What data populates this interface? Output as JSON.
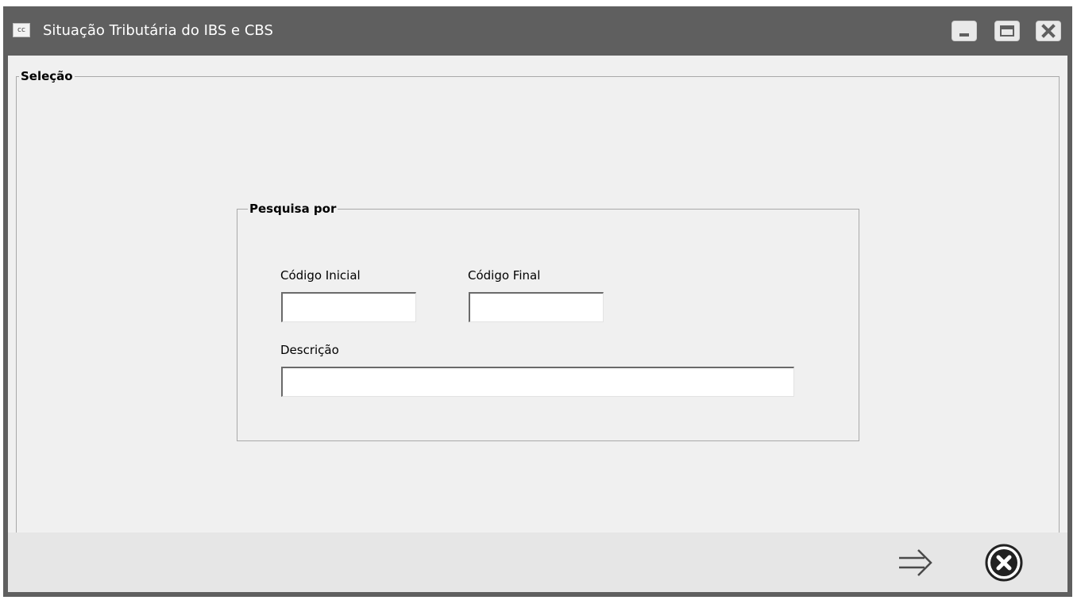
{
  "window": {
    "app_icon_label": "cc",
    "title": "Situação Tributária do IBS e CBS",
    "controls": [
      "minimize-icon",
      "maximize-icon",
      "close-icon"
    ]
  },
  "selecao": {
    "legend": "Seleção",
    "pesquisa": {
      "legend": "Pesquisa por",
      "codigo_inicial": {
        "label": "Código Inicial",
        "value": ""
      },
      "codigo_final": {
        "label": "Código Final",
        "value": ""
      },
      "descricao": {
        "label": "Descrição",
        "value": ""
      }
    }
  },
  "footer": {
    "actions": [
      "arrow-right-icon",
      "cancel-x-circle-icon"
    ]
  },
  "colors": {
    "titlebar": "#5f5f5f",
    "client_bg": "#f0f0f0",
    "footer_bg": "#e6e6e6"
  }
}
